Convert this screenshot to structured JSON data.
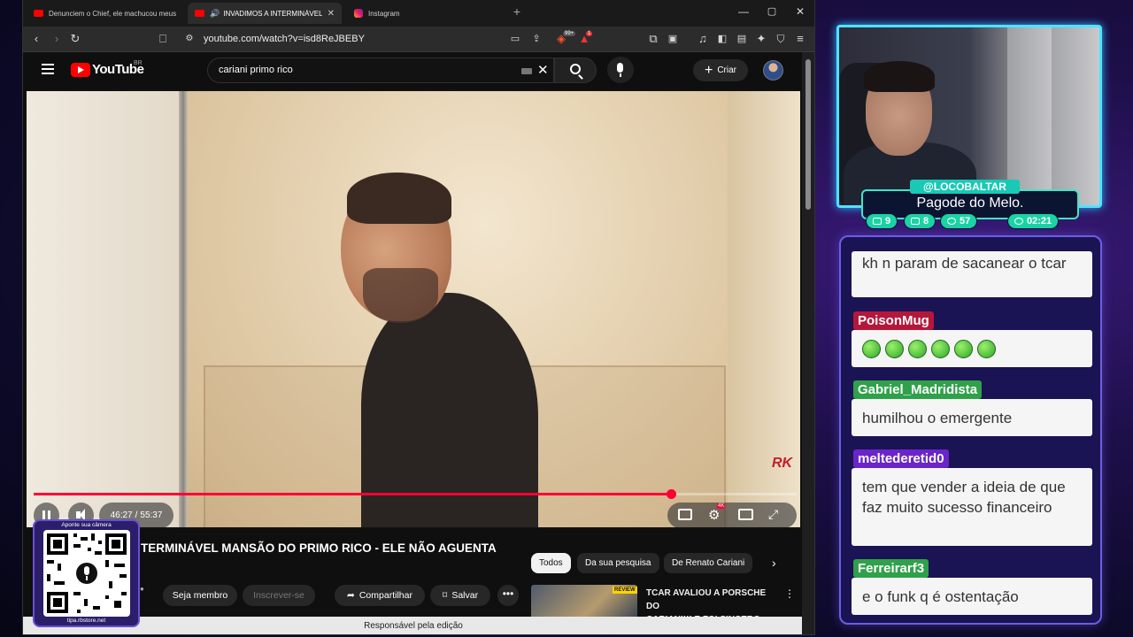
{
  "browser": {
    "tabs": [
      {
        "label": "Denunciem o Chief, ele machucou meus sent",
        "icon": "youtube-icon",
        "active": false
      },
      {
        "label": "INVADIMOS A INTERMINÁVEL MAN",
        "icon": "youtube-icon",
        "active": true
      },
      {
        "label": "Instagram",
        "icon": "instagram-icon",
        "active": false
      }
    ],
    "new_tab": "+",
    "url": "youtube.com/watch?v=isd8ReJBEBY",
    "shield_badge": "99+",
    "alert_badge": "1"
  },
  "youtube": {
    "logo_text": "YouTube",
    "region": "BR",
    "search_query": "cariani primo rico",
    "create_label": "Criar",
    "video": {
      "elapsed": "46:27",
      "duration": "55:37",
      "progress": 0.8352,
      "watermark": "RK",
      "hd_badge": "4K"
    },
    "title": "TERMINÁVEL MANSÃO DO PRIMO RICO - ELE NÃO AGUENTA",
    "actions": {
      "join": "Seja membro",
      "subscribe": "Inscrever-se",
      "share": "Compartilhar",
      "save": "Salvar",
      "more": "•••"
    },
    "chips": [
      "Todos",
      "Da sua pesquisa",
      "De Renato Cariani"
    ],
    "recommendation": {
      "title_line1": "TCAR AVALIOU A PORSCHE DO",
      "title_line2": "CARIANI!!! E FOI SINCERO...",
      "tag": "REVIEW"
    },
    "status_bar": "Responsável pela edição"
  },
  "qr": {
    "top_text": "Aponte sua câmera",
    "bottom_text": "tipa.rbstore.net"
  },
  "stream": {
    "handle": "@LOCOBALTAR",
    "status": "Pagode do Melo.",
    "stats": [
      {
        "icon": "twitch-icon",
        "value": "9"
      },
      {
        "icon": "youtube-icon",
        "value": "8"
      },
      {
        "icon": "kick-icon",
        "value": "57"
      },
      {
        "icon": "clock-icon",
        "value": "02:21"
      }
    ]
  },
  "chat": {
    "messages": [
      {
        "user": "",
        "text": "kh n param de sacanear o tcar",
        "color": ""
      },
      {
        "user": "PoisonMug",
        "text": "",
        "color": "#b5173a",
        "emote_count": 6
      },
      {
        "user": "Gabriel_Madridista",
        "text": "humilhou o emergente",
        "color": "#2fa14a"
      },
      {
        "user": "meltederetid0",
        "text": "tem que vender a ideia de que faz muito sucesso financeiro",
        "color": "#6b24c9"
      },
      {
        "user": "Ferreirarf3",
        "text": "e o funk q é ostentação",
        "color": "#2fa14a"
      }
    ]
  }
}
